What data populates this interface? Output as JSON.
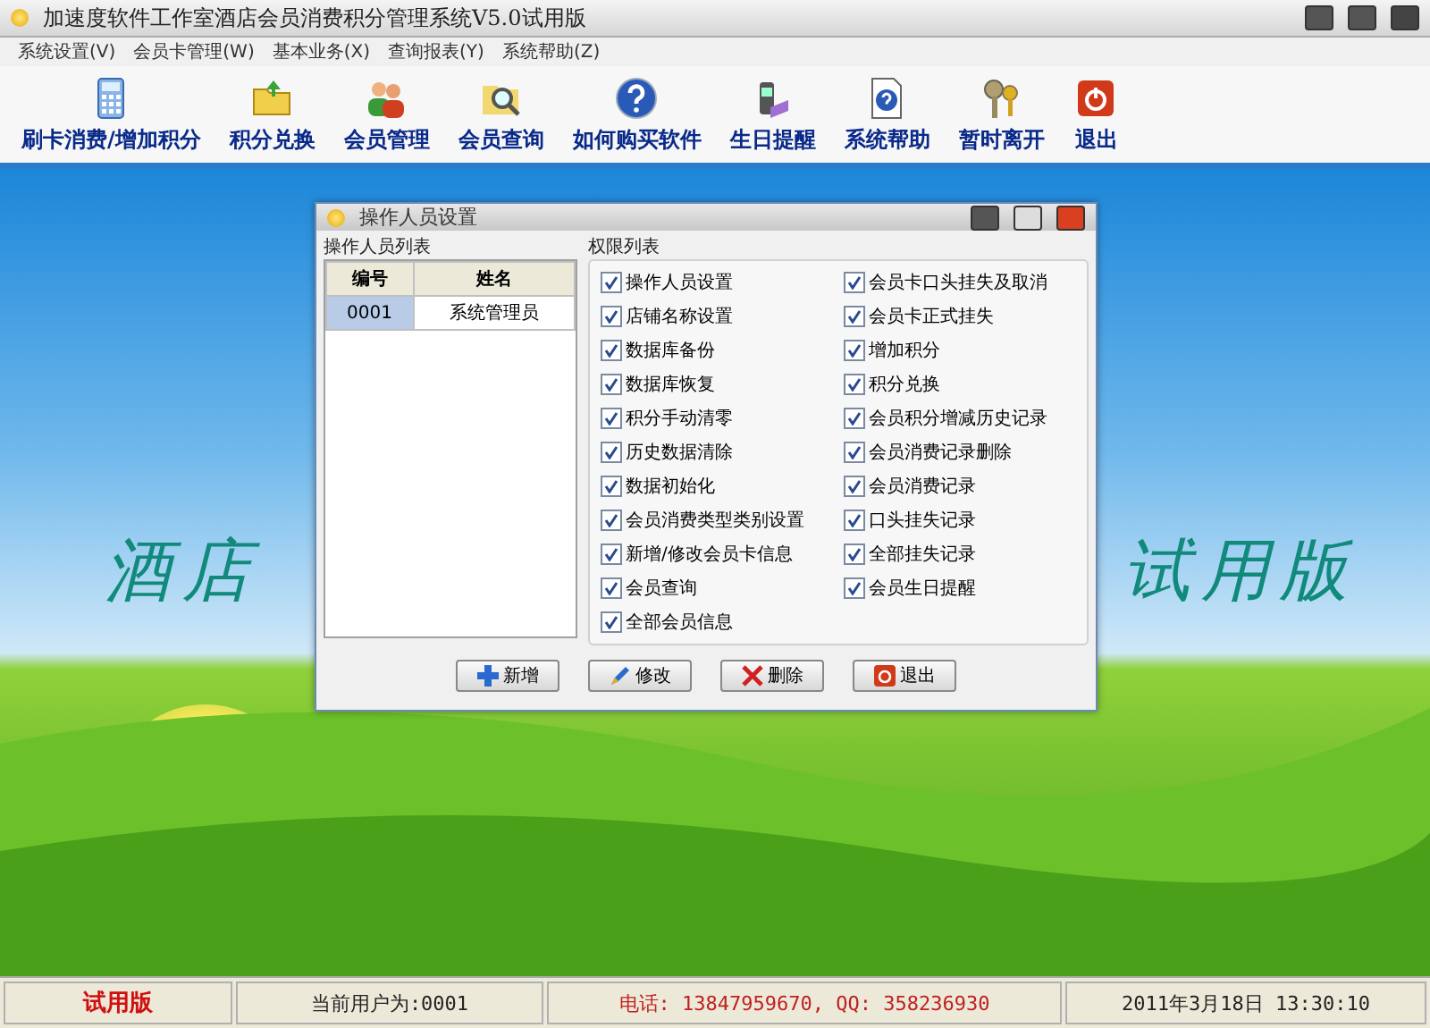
{
  "window": {
    "title": "加速度软件工作室酒店会员消费积分管理系统V5.0试用版"
  },
  "menu": [
    "系统设置(V)",
    "会员卡管理(W)",
    "基本业务(X)",
    "查询报表(Y)",
    "系统帮助(Z)"
  ],
  "toolbar": [
    {
      "label": "刷卡消费/增加积分",
      "kind": "calculator"
    },
    {
      "label": "积分兑换",
      "kind": "folder"
    },
    {
      "label": "会员管理",
      "kind": "people"
    },
    {
      "label": "会员查询",
      "kind": "search"
    },
    {
      "label": "如何购买软件",
      "kind": "help"
    },
    {
      "label": "生日提醒",
      "kind": "phone"
    },
    {
      "label": "系统帮助",
      "kind": "doc"
    },
    {
      "label": "暂时离开",
      "kind": "keys"
    },
    {
      "label": "退出",
      "kind": "exit"
    }
  ],
  "banner": {
    "left": "酒店",
    "right": "试用版"
  },
  "dialog": {
    "title": "操作人员设置",
    "operators": {
      "heading": "操作人员列表",
      "columns": [
        "编号",
        "姓名"
      ],
      "rows": [
        {
          "cells": [
            "0001",
            "系统管理员"
          ],
          "selected": true
        }
      ]
    },
    "permissions": {
      "heading": "权限列表",
      "left": [
        {
          "label": "操作人员设置",
          "checked": true
        },
        {
          "label": "店铺名称设置",
          "checked": true
        },
        {
          "label": "数据库备份",
          "checked": true
        },
        {
          "label": "数据库恢复",
          "checked": true
        },
        {
          "label": "积分手动清零",
          "checked": true
        },
        {
          "label": "历史数据清除",
          "checked": true
        },
        {
          "label": "数据初始化",
          "checked": true
        },
        {
          "label": "会员消费类型类别设置",
          "checked": true
        },
        {
          "label": "新增/修改会员卡信息",
          "checked": true
        },
        {
          "label": "会员查询",
          "checked": true
        },
        {
          "label": "全部会员信息",
          "checked": true
        }
      ],
      "right": [
        {
          "label": "会员卡口头挂失及取消",
          "checked": true
        },
        {
          "label": "会员卡正式挂失",
          "checked": true
        },
        {
          "label": "增加积分",
          "checked": true
        },
        {
          "label": "积分兑换",
          "checked": true
        },
        {
          "label": "会员积分增减历史记录",
          "checked": true
        },
        {
          "label": "会员消费记录删除",
          "checked": true
        },
        {
          "label": "会员消费记录",
          "checked": true
        },
        {
          "label": "口头挂失记录",
          "checked": true
        },
        {
          "label": "全部挂失记录",
          "checked": true
        },
        {
          "label": "会员生日提醒",
          "checked": true
        }
      ]
    },
    "buttons": [
      {
        "label": "新增",
        "kind": "add"
      },
      {
        "label": "修改",
        "kind": "edit"
      },
      {
        "label": "删除",
        "kind": "delete"
      },
      {
        "label": "退出",
        "kind": "exit"
      }
    ]
  },
  "status_bar": {
    "edition": "试用版",
    "user": "当前用户为:0001",
    "contact": "电话: 13847959670, QQ: 358236930",
    "datetime": "2011年3月18日  13:30:10"
  }
}
